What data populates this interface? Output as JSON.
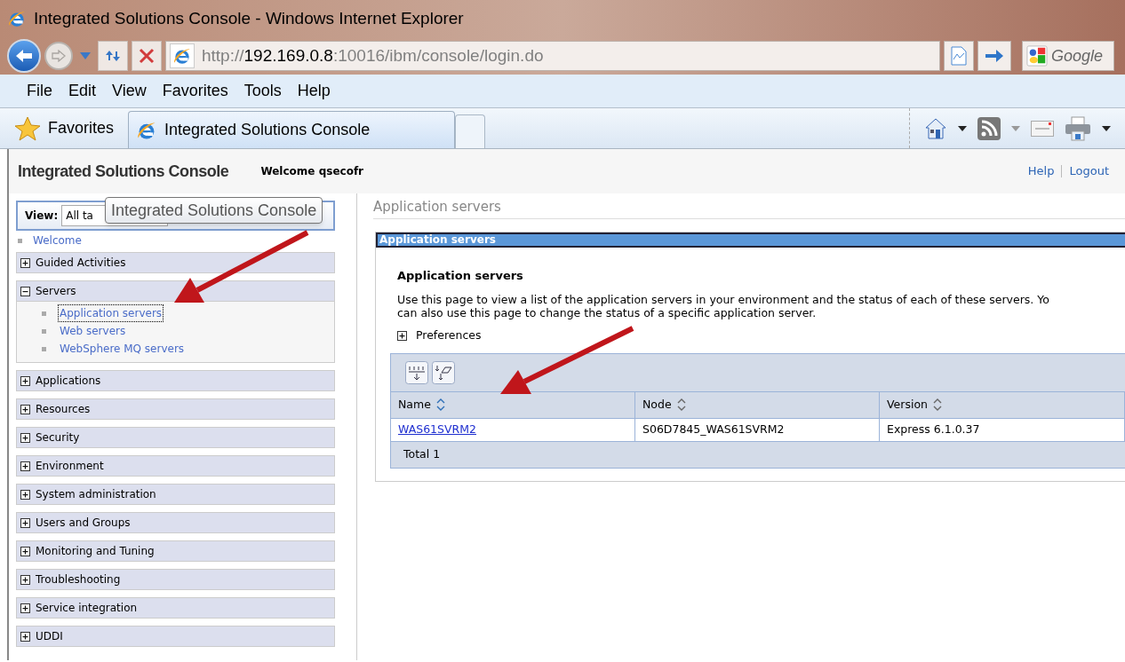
{
  "window": {
    "title": "Integrated Solutions Console - Windows Internet Explorer"
  },
  "address": {
    "scheme": "http://",
    "host": "192.169.0.8",
    "rest": ":10016/ibm/console/login.do"
  },
  "search": {
    "placeholder": "Google"
  },
  "menu": [
    "File",
    "Edit",
    "View",
    "Favorites",
    "Tools",
    "Help"
  ],
  "favorites": {
    "label": "Favorites"
  },
  "tabs": [
    {
      "label": "Integrated Solutions Console",
      "selected": true
    }
  ],
  "header": {
    "title": "Integrated Solutions Console",
    "welcome": "Welcome qsecofr",
    "links": [
      "Help",
      "Logout"
    ]
  },
  "sidebar": {
    "view_label": "View:",
    "view_value": "All ta",
    "tooltip": "Integrated Solutions Console",
    "welcome": "Welcome",
    "groups": [
      {
        "label": "Guided Activities",
        "expanded": false
      },
      {
        "label": "Servers",
        "expanded": true,
        "children": [
          {
            "label": "Application servers",
            "selected": true
          },
          {
            "label": "Web servers",
            "selected": false
          },
          {
            "label": "WebSphere MQ servers",
            "selected": false
          }
        ]
      },
      {
        "label": "Applications",
        "expanded": false
      },
      {
        "label": "Resources",
        "expanded": false
      },
      {
        "label": "Security",
        "expanded": false
      },
      {
        "label": "Environment",
        "expanded": false
      },
      {
        "label": "System administration",
        "expanded": false
      },
      {
        "label": "Users and Groups",
        "expanded": false
      },
      {
        "label": "Monitoring and Tuning",
        "expanded": false
      },
      {
        "label": "Troubleshooting",
        "expanded": false
      },
      {
        "label": "Service integration",
        "expanded": false
      },
      {
        "label": "UDDI",
        "expanded": false
      }
    ]
  },
  "main": {
    "breadcrumb": "Application servers",
    "panel_title": "Application servers",
    "heading": "Application servers",
    "description_lines": [
      "Use this page to view a list of the application servers in your environment and the status of each of these servers. Yo",
      "can also use this page to change the status of a specific application server."
    ],
    "preferences": {
      "label": "Preferences",
      "expanded": false
    },
    "table": {
      "columns": [
        {
          "label": "Name",
          "sorted": true
        },
        {
          "label": "Node",
          "sorted": false
        },
        {
          "label": "Version",
          "sorted": false
        }
      ],
      "rows": [
        [
          "WAS61SVRM2",
          "S06D7845_WAS61SVRM2",
          "Express 6.1.0.37"
        ]
      ],
      "total": "Total 1"
    }
  }
}
